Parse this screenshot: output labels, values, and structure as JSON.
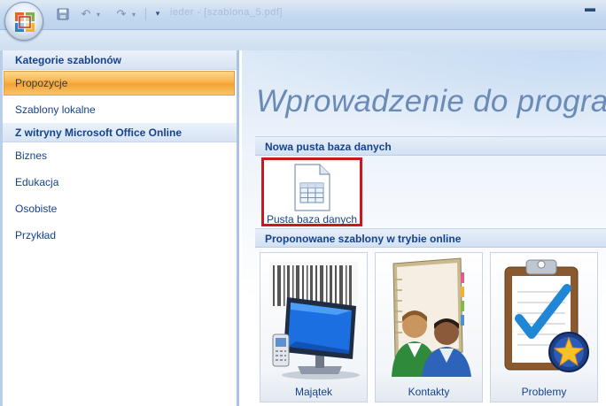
{
  "titlebar": {
    "window_title": "ieder - [szablona_5.pdf]",
    "icons": [
      "office-button",
      "save-icon",
      "undo-icon",
      "redo-icon",
      "customize-qat-icon",
      "minimize-icon"
    ]
  },
  "left_panel": {
    "section_templates": "Kategorie szablonów",
    "items_templates": [
      {
        "label": "Propozycje",
        "selected": true
      },
      {
        "label": "Szablony lokalne",
        "selected": false
      }
    ],
    "section_online": "Z witryny Microsoft Office Online",
    "items_online": [
      {
        "label": "Biznes"
      },
      {
        "label": "Edukacja"
      },
      {
        "label": "Osobiste"
      },
      {
        "label": "Przykład"
      }
    ]
  },
  "right_panel": {
    "welcome_title": "Wprowadzenie do programu",
    "section_blank": "Nowa pusta baza danych",
    "blank_tile_label": "Pusta baza danych",
    "section_online_templates": "Proponowane szablony w trybie online",
    "tiles": [
      {
        "label": "Majątek",
        "icon": "assets-computer-icon"
      },
      {
        "label": "Kontakty",
        "icon": "contacts-people-icon"
      },
      {
        "label": "Problemy",
        "icon": "issues-clipboard-icon"
      }
    ]
  },
  "colors": {
    "selection_orange": "#f5a236",
    "heading_blue": "#15428b",
    "highlight_red": "#c8191e"
  }
}
